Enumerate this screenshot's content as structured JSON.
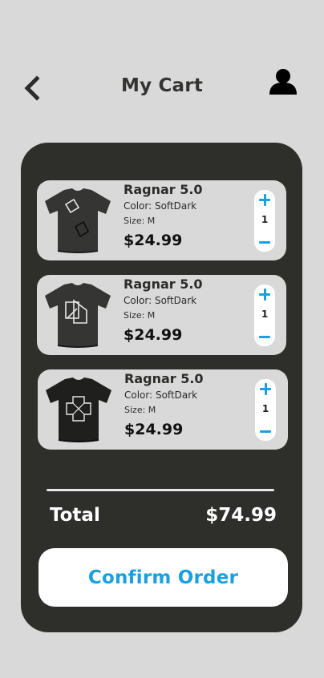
{
  "header": {
    "title": "My Cart",
    "back_icon": "chevron-left-icon",
    "user_icon": "user-icon"
  },
  "cart": {
    "items": [
      {
        "name": "Ragnar 5.0",
        "color_label": "Color: SoftDark",
        "size_label": "Size: M",
        "price": "$24.99",
        "quantity": "1"
      },
      {
        "name": "Ragnar 5.0",
        "color_label": "Color: SoftDark",
        "size_label": "Size: M",
        "price": "$24.99",
        "quantity": "1"
      },
      {
        "name": "Ragnar 5.0",
        "color_label": "Color: SoftDark",
        "size_label": "Size: M",
        "price": "$24.99",
        "quantity": "1"
      }
    ],
    "total_label": "Total",
    "total_value": "$74.99",
    "confirm_label": "Confirm Order"
  },
  "colors": {
    "background": "#d9d9d9",
    "panel": "#2e2e2b",
    "accent": "#1aa0e0",
    "card": "#d9d9d9"
  }
}
